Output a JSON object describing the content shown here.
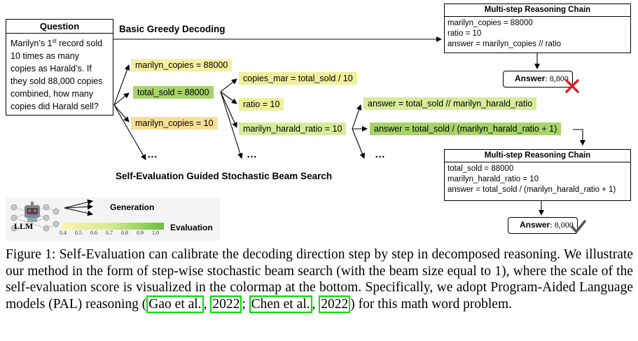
{
  "question": {
    "title": "Question",
    "lines": [
      "Marilyn’s 1",
      "10 times as many",
      "copies as Harald’s. If",
      "they sold 88,000 copies",
      "combined, how many",
      "copies did Harald sell?"
    ],
    "line1_sup": "st",
    "line1_rest": " record sold"
  },
  "labels": {
    "basic_greedy": "Basic Greedy Decoding",
    "beam_search": "Self-Evaluation Guided Stochastic Beam Search"
  },
  "tree": {
    "level1": [
      "marilyn_copies = 88000",
      "total_sold = 88000",
      "marilyn_copies = 10"
    ],
    "level2": [
      "copies_mar = total_sold / 10",
      "ratio = 10",
      "marilyn_harald_ratio = 10"
    ],
    "level3": [
      "answer = total_sold // marilyn_harald_ratio",
      "answer = total_sold / (marilyn_harald_ratio + 1)"
    ],
    "ellipsis": "…"
  },
  "chain_top": {
    "title": "Multi-step Reasoning Chain",
    "lines": [
      "marilyn_copies = 88000",
      "ratio = 10",
      "answer = marilyn_copies // ratio"
    ],
    "answer_label": "Answer",
    "answer_value": ": 8,800"
  },
  "chain_bottom": {
    "title": "Multi-step Reasoning Chain",
    "lines": [
      "total_sold = 88000",
      "marilyn_harald_ratio = 10",
      "answer = total_sold / (marilyn_harald_ratio + 1)"
    ],
    "answer_label": "Answer",
    "answer_value": ": 8,000"
  },
  "legend": {
    "generation": "Generation",
    "evaluation": "Evaluation",
    "llm": "LLM",
    "scale_ticks": [
      "0.4",
      "0.5",
      "0.6",
      "0.7",
      "0.8",
      "0.9",
      "1.0"
    ],
    "colors": {
      "low": "#fff3b0",
      "high": "#6cbf3a"
    }
  },
  "caption": {
    "p1": "Figure 1: Self-Evaluation can calibrate the decoding direction step by step in decomposed reasoning. We illustrate our method in the form of step-wise stochastic beam search (with the beam size equal to 1), where the scale of the self-evaluation score is visualized in the colormap at the bottom. Specifically, we adopt Program-Aided Language models (PAL) reasoning (",
    "cite1_name": "Gao et al.",
    "cite1_year": "2022",
    "cite2_name": "Chen et al.",
    "cite2_year": "2022",
    "sep1": ", ",
    "sep2": "; ",
    "p2": ") for this math word problem."
  }
}
